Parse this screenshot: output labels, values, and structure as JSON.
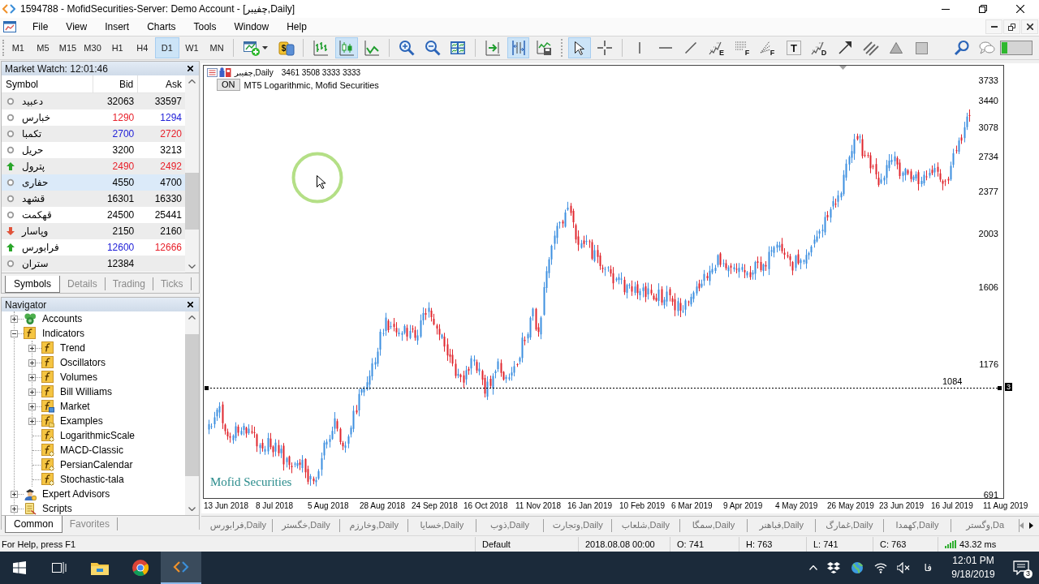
{
  "window": {
    "title": "1594788 - MofidSecurities-Server: Demo Account - [چفیبر,Daily]"
  },
  "menu": [
    "File",
    "View",
    "Insert",
    "Charts",
    "Tools",
    "Window",
    "Help"
  ],
  "toolbar": {
    "timeframes": [
      {
        "label": "M1",
        "selected": false
      },
      {
        "label": "M5",
        "selected": false
      },
      {
        "label": "M15",
        "selected": false
      },
      {
        "label": "M30",
        "selected": false
      },
      {
        "label": "H1",
        "selected": false
      },
      {
        "label": "H4",
        "selected": false
      },
      {
        "label": "D1",
        "selected": true
      },
      {
        "label": "W1",
        "selected": false
      },
      {
        "label": "MN",
        "selected": false
      }
    ],
    "tool_groups": [
      [
        {
          "kind": "new-chart",
          "selected": false
        },
        {
          "kind": "market",
          "letter": "$",
          "selected": false
        }
      ],
      [
        {
          "kind": "bar-chart",
          "selected": false
        },
        {
          "kind": "candle-chart",
          "selected": true
        },
        {
          "kind": "line-chart",
          "selected": false
        }
      ],
      [
        {
          "kind": "zoom-in",
          "selected": false
        },
        {
          "kind": "zoom-out",
          "selected": false
        },
        {
          "kind": "tile",
          "selected": false
        }
      ],
      [
        {
          "kind": "autoscroll",
          "selected": false
        },
        {
          "kind": "chart-shift",
          "selected": true
        },
        {
          "kind": "templates",
          "selected": false
        }
      ],
      [
        {
          "kind": "cursor",
          "selected": true
        },
        {
          "kind": "crosshair",
          "selected": false
        }
      ],
      [
        {
          "kind": "vline",
          "selected": false
        },
        {
          "kind": "hline",
          "selected": false
        },
        {
          "kind": "trendline",
          "selected": false
        },
        {
          "kind": "stairs",
          "letter": "E",
          "selected": false
        },
        {
          "kind": "dotted-levels",
          "letter": "F",
          "selected": false
        },
        {
          "kind": "fan",
          "letter": "F",
          "selected": false
        },
        {
          "kind": "text",
          "letter": "T",
          "selected": false
        },
        {
          "kind": "stairs",
          "letter": "D",
          "selected": false
        },
        {
          "kind": "arrow",
          "selected": false
        },
        {
          "kind": "channel",
          "selected": false
        },
        {
          "kind": "triangle",
          "selected": false
        },
        {
          "kind": "rectangle",
          "selected": false
        }
      ],
      [
        {
          "kind": "search",
          "selected": false
        },
        {
          "kind": "chat",
          "selected": false
        }
      ]
    ]
  },
  "market_watch": {
    "title": "Market Watch: 12:01:46",
    "columns": [
      "Symbol",
      "Bid",
      "Ask"
    ],
    "rows": [
      {
        "symbol": "دعبید",
        "kind": "flat",
        "bid": {
          "value": "32063",
          "color": "#000000"
        },
        "ask": {
          "value": "33597",
          "color": "#000000"
        },
        "selected": false
      },
      {
        "symbol": "خبارس",
        "kind": "flat",
        "bid": {
          "value": "1290",
          "color": "#e8202a"
        },
        "ask": {
          "value": "1294",
          "color": "#2020d8"
        },
        "selected": false
      },
      {
        "symbol": "تکمبا",
        "kind": "flat",
        "bid": {
          "value": "2700",
          "color": "#2020d8"
        },
        "ask": {
          "value": "2720",
          "color": "#e8202a"
        },
        "selected": false
      },
      {
        "symbol": "حریل",
        "kind": "flat",
        "bid": {
          "value": "3200",
          "color": "#000000"
        },
        "ask": {
          "value": "3213",
          "color": "#000000"
        },
        "selected": false
      },
      {
        "symbol": "پترول",
        "kind": "up",
        "bid": {
          "value": "2490",
          "color": "#e8202a"
        },
        "ask": {
          "value": "2492",
          "color": "#e8202a"
        },
        "selected": false
      },
      {
        "symbol": "حفاری",
        "kind": "flat",
        "bid": {
          "value": "4550",
          "color": "#000000"
        },
        "ask": {
          "value": "4700",
          "color": "#000000"
        },
        "selected": true
      },
      {
        "symbol": "قشهد",
        "kind": "flat",
        "bid": {
          "value": "16301",
          "color": "#000000"
        },
        "ask": {
          "value": "16330",
          "color": "#000000"
        },
        "selected": false
      },
      {
        "symbol": "قهکمت",
        "kind": "flat",
        "bid": {
          "value": "24500",
          "color": "#000000"
        },
        "ask": {
          "value": "25441",
          "color": "#000000"
        },
        "selected": false
      },
      {
        "symbol": "وپاسار",
        "kind": "down",
        "bid": {
          "value": "2150",
          "color": "#000000"
        },
        "ask": {
          "value": "2160",
          "color": "#000000"
        },
        "selected": false
      },
      {
        "symbol": "فرابورس",
        "kind": "up",
        "bid": {
          "value": "12600",
          "color": "#2020d8"
        },
        "ask": {
          "value": "12666",
          "color": "#e8202a"
        },
        "selected": false
      },
      {
        "symbol": "ستران",
        "kind": "flat",
        "bid": {
          "value": "12384",
          "color": "#000000"
        },
        "selected": false
      }
    ],
    "tabs": [
      {
        "label": "Symbols",
        "selected": true
      },
      {
        "label": "Details",
        "selected": false
      },
      {
        "label": "Trading",
        "selected": false
      },
      {
        "label": "Ticks",
        "selected": false
      }
    ]
  },
  "navigator": {
    "title": "Navigator",
    "items": [
      {
        "label": "Accounts",
        "kind": "accounts",
        "expanded": false
      },
      {
        "label": "Indicators",
        "kind": "folder",
        "expanded": true,
        "children": [
          {
            "label": "Trend",
            "kind": "folder",
            "expanded": false
          },
          {
            "label": "Oscillators",
            "kind": "folder",
            "expanded": false
          },
          {
            "label": "Volumes",
            "kind": "folder",
            "expanded": false
          },
          {
            "label": "Bill Williams",
            "kind": "folder",
            "expanded": false
          },
          {
            "label": "Market",
            "kind": "market",
            "expanded": false
          },
          {
            "label": "Examples",
            "kind": "examples",
            "expanded": false
          },
          {
            "label": "LogarithmicScale",
            "kind": "indicator"
          },
          {
            "label": "MACD-Classic",
            "kind": "indicator"
          },
          {
            "label": "PersianCalendar",
            "kind": "indicator"
          },
          {
            "label": "Stochastic-tala",
            "kind": "indicator"
          }
        ]
      },
      {
        "label": "Expert Advisors",
        "kind": "experts",
        "expanded": false
      },
      {
        "label": "Scripts",
        "kind": "scripts",
        "expanded": false
      }
    ],
    "tabs": [
      {
        "label": "Common",
        "selected": true
      },
      {
        "label": "Favorites",
        "selected": false
      }
    ]
  },
  "chart": {
    "symbol": "چفیبر,Daily",
    "prices": "3461 3508 3333 3333",
    "indicator_toggle": "ON",
    "indicator_label": "MT5 Logarithmic, Mofid Securities",
    "chart_label": "Mofid Securities",
    "price_labels": [
      "3733",
      "3440",
      "3078",
      "2734",
      "2377",
      "2003",
      "1606",
      "1176",
      "691"
    ],
    "level_line": {
      "label": "1084",
      "tag": "3"
    },
    "date_labels": [
      "13 Jun 2018",
      "8 Jul 2018",
      "5 Aug 2018",
      "28 Aug 2018",
      "24 Sep 2018",
      "16 Oct 2018",
      "11 Nov 2018",
      "16 Jan 2019",
      "10 Feb 2019",
      "6 Mar 2019",
      "9 Apr 2019",
      "4 May 2019",
      "26 May 2019",
      "23 Jun 2019",
      "16 Jul 2019",
      "11 Aug 2019"
    ]
  },
  "chart_tabs": [
    {
      "label": "فرابورس,Daily",
      "selected": false
    },
    {
      "label": "خگستر,Daily",
      "selected": false
    },
    {
      "label": "وخارزم,Daily",
      "selected": false
    },
    {
      "label": "خسایا,Daily",
      "selected": false
    },
    {
      "label": "ذوب,Daily",
      "selected": false
    },
    {
      "label": "وتجارت,Daily",
      "selected": false
    },
    {
      "label": "شلعاب,Daily",
      "selected": false
    },
    {
      "label": "سمگا,Daily",
      "selected": false
    },
    {
      "label": "فباهنر,Daily",
      "selected": false
    },
    {
      "label": "غمارگ,Daily",
      "selected": false
    },
    {
      "label": "کهمدا,Daily",
      "selected": false
    },
    {
      "label": "وگستر,Da",
      "selected": false
    }
  ],
  "status_bar": {
    "help": "For Help, press F1",
    "profile": "Default",
    "time": "2018.08.08 00:00",
    "open": "O: 741",
    "high": "H: 763",
    "low": "L: 741",
    "close": "C: 763",
    "ping": "43.32 ms"
  },
  "taskbar": {
    "apps": [
      {
        "kind": "task-view",
        "selected": false
      },
      {
        "kind": "explorer",
        "selected": false
      },
      {
        "kind": "browser",
        "selected": false
      },
      {
        "kind": "terminal",
        "selected": true
      }
    ],
    "language": "فا",
    "time": "12:01 PM",
    "date": "9/18/2019",
    "notifications": "3"
  }
}
